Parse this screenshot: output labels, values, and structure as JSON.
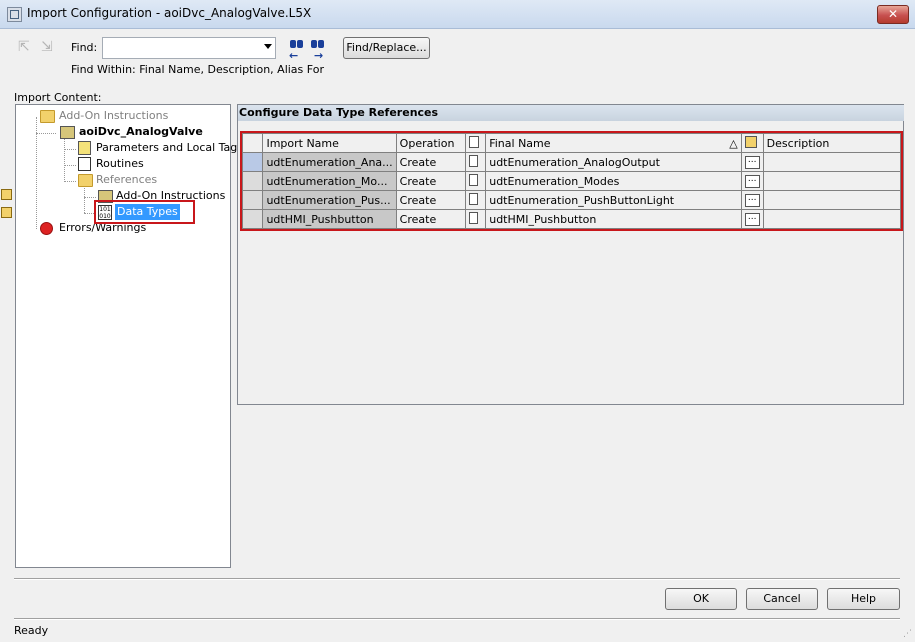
{
  "window": {
    "title": "Import Configuration - aoiDvc_AnalogValve.L5X",
    "close_label": "✕"
  },
  "toolbar": {
    "find_label": "Find:",
    "find_value": "",
    "find_replace_label": "Find/Replace...",
    "find_within": "Find Within: Final Name, Description, Alias For"
  },
  "import_content": {
    "label": "Import Content:",
    "tree": {
      "add_on_instructions": "Add-On Instructions",
      "aoi": "aoiDvc_AnalogValve",
      "params": "Parameters and Local Tags",
      "routines": "Routines",
      "references": "References",
      "ref_aoi": "Add-On Instructions",
      "data_types": "Data Types",
      "errors": "Errors/Warnings"
    }
  },
  "main": {
    "header": "Configure Data Type References",
    "columns": {
      "import_name": "Import Name",
      "operation": "Operation",
      "final_name": "Final Name",
      "sort_indicator": "△",
      "description": "Description"
    },
    "rows": [
      {
        "import_name": "udtEnumeration_Ana...",
        "operation": "Create",
        "final_name": "udtEnumeration_AnalogOutput",
        "description": ""
      },
      {
        "import_name": "udtEnumeration_Mo...",
        "operation": "Create",
        "final_name": "udtEnumeration_Modes",
        "description": ""
      },
      {
        "import_name": "udtEnumeration_Pus...",
        "operation": "Create",
        "final_name": "udtEnumeration_PushButtonLight",
        "description": ""
      },
      {
        "import_name": "udtHMI_Pushbutton",
        "operation": "Create",
        "final_name": "udtHMI_Pushbutton",
        "description": ""
      }
    ],
    "ellipsis": "..."
  },
  "buttons": {
    "ok": "OK",
    "cancel": "Cancel",
    "help": "Help"
  },
  "status": "Ready",
  "colors": {
    "highlight": "#c8171b",
    "selection": "#3399ff"
  }
}
